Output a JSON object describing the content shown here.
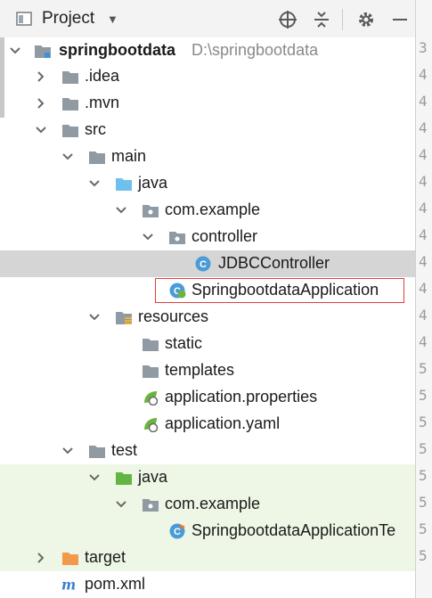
{
  "toolbar": {
    "title": "Project",
    "buttons": [
      "locate-icon",
      "collapse-all-icon",
      "gear-icon",
      "minimize-icon"
    ]
  },
  "tree": {
    "root": {
      "label": "springbootdata",
      "path": "D:\\springbootdata"
    },
    "idea": ".idea",
    "mvn": ".mvn",
    "src": "src",
    "main": "main",
    "main_java": "java",
    "main_pkg": "com.example",
    "controller": "controller",
    "jdbc_controller": "JDBCController",
    "app_class": "SpringbootdataApplication",
    "resources": "resources",
    "static": "static",
    "templates": "templates",
    "app_properties": "application.properties",
    "app_yaml": "application.yaml",
    "test": "test",
    "test_java": "java",
    "test_pkg": "com.example",
    "test_class": "SpringbootdataApplicationTe",
    "target": "target",
    "pom": "pom.xml"
  },
  "gutter": [
    "3",
    "4",
    "4",
    "4",
    "4",
    "4",
    "4",
    "4",
    "4",
    "4",
    "4",
    "4",
    "5",
    "5",
    "5",
    "5",
    "5",
    "5",
    "5",
    "5"
  ]
}
